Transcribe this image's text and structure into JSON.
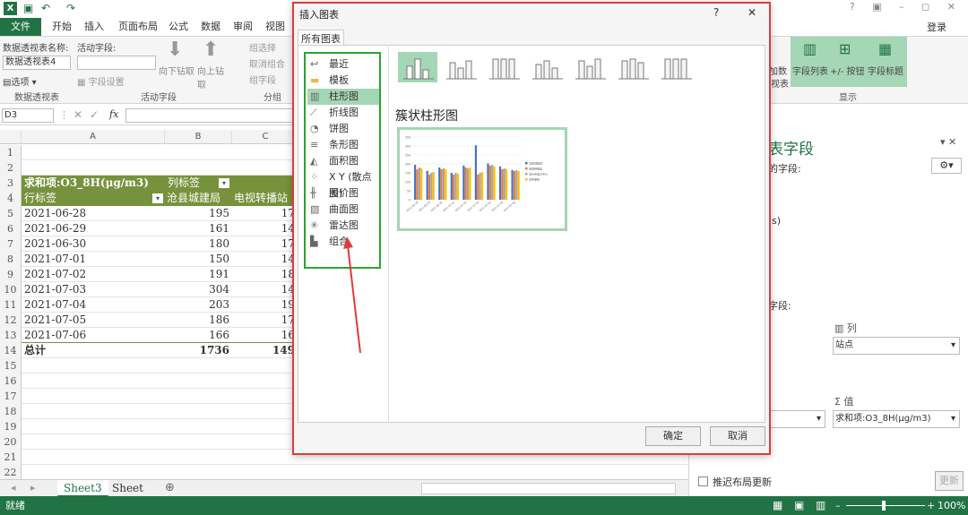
{
  "app": {
    "logo": "X",
    "login": "登录",
    "window_controls": "? ▣ – ◻ ✕"
  },
  "ribbon_tabs": [
    "文件",
    "开始",
    "插入",
    "页面布局",
    "公式",
    "数据",
    "审阅",
    "视图"
  ],
  "ribbon": {
    "pivot_name_label": "数据透视表名称:",
    "pivot_name_value": "数据透视表4",
    "options_label": "选项",
    "group1": "数据透视表",
    "active_field_label": "活动字段:",
    "field_settings": "字段设置",
    "drill_down": "向下钻取",
    "drill_up": "向上钻取",
    "group2": "活动字段",
    "group_select": "组选择",
    "ungroup": "取消组合",
    "group_field": "组字段",
    "group3": "分组",
    "field_list": "字段列表",
    "plus_minus": "+/- 按钮",
    "field_headers": "字段标题",
    "group4": "显示",
    "partial_left": "加数",
    "partial_left2": "视表"
  },
  "formula_bar": {
    "name_box": "D3",
    "fx": "fx"
  },
  "sheet": {
    "columns": [
      "A",
      "B",
      "C"
    ],
    "row_numbers": [
      "1",
      "2",
      "3",
      "4",
      "5",
      "6",
      "7",
      "8",
      "9",
      "10",
      "11",
      "12",
      "13",
      "14",
      "15",
      "16",
      "17",
      "18",
      "19",
      "20",
      "21",
      "22"
    ],
    "header_row3": [
      "求和项:O3_8H(μg/m3)",
      "列标签"
    ],
    "header_row4": [
      "行标签",
      "沧县城建局",
      "电视转播站"
    ],
    "rows": [
      [
        "2021-06-28",
        "195",
        "17"
      ],
      [
        "2021-06-29",
        "161",
        "14"
      ],
      [
        "2021-06-30",
        "180",
        "17"
      ],
      [
        "2021-07-01",
        "150",
        "14"
      ],
      [
        "2021-07-02",
        "191",
        "18"
      ],
      [
        "2021-07-03",
        "304",
        "14"
      ],
      [
        "2021-07-04",
        "203",
        "19"
      ],
      [
        "2021-07-05",
        "186",
        "17"
      ],
      [
        "2021-07-06",
        "166",
        "16"
      ]
    ],
    "total_row": [
      "总计",
      "1736",
      "149"
    ]
  },
  "sheet_tabs": [
    "Sheet3",
    "Sheet"
  ],
  "status_bar": {
    "ready": "就绪",
    "zoom": "100%"
  },
  "dialog": {
    "title": "插入图表",
    "help": "?",
    "close": "✕",
    "tab": "所有图表",
    "chart_types": [
      {
        "label": "最近",
        "icon": "recent-icon"
      },
      {
        "label": "模板",
        "icon": "folder-icon"
      },
      {
        "label": "柱形图",
        "icon": "column-chart-icon"
      },
      {
        "label": "折线图",
        "icon": "line-chart-icon"
      },
      {
        "label": "饼图",
        "icon": "pie-chart-icon"
      },
      {
        "label": "条形图",
        "icon": "bar-chart-icon"
      },
      {
        "label": "面积图",
        "icon": "area-chart-icon"
      },
      {
        "label": "X Y (散点图)",
        "icon": "scatter-chart-icon"
      },
      {
        "label": "股价图",
        "icon": "stock-chart-icon"
      },
      {
        "label": "曲面图",
        "icon": "surface-chart-icon"
      },
      {
        "label": "雷达图",
        "icon": "radar-chart-icon"
      },
      {
        "label": "组合",
        "icon": "combo-chart-icon"
      }
    ],
    "selected_type": "柱形图",
    "subtype_title": "簇状柱形图",
    "ok": "确定",
    "cancel": "取消"
  },
  "preview_chart": {
    "y_ticks": [
      "350",
      "300",
      "250",
      "200",
      "150",
      "100",
      "50",
      "0"
    ],
    "x_labels": [
      "2021-06-28",
      "2021-06-29",
      "2021-06-30",
      "2021-07-01",
      "2021-07-02",
      "2021-07-03",
      "2021-07-04",
      "2021-07-05",
      "2021-07-06"
    ],
    "legend": [
      "沧县城建局",
      "电视转播站",
      "沧州市电力中心",
      "市环保局"
    ],
    "colors": [
      "#4472c4",
      "#ed7d31",
      "#a5a5a5",
      "#ffc000"
    ]
  },
  "chart_data": {
    "type": "bar",
    "categories": [
      "2021-06-28",
      "2021-06-29",
      "2021-06-30",
      "2021-07-01",
      "2021-07-02",
      "2021-07-03",
      "2021-07-04",
      "2021-07-05",
      "2021-07-06"
    ],
    "series": [
      {
        "name": "沧县城建局",
        "values": [
          195,
          161,
          180,
          150,
          191,
          304,
          203,
          186,
          166
        ]
      },
      {
        "name": "电视转播站",
        "values": [
          170,
          140,
          170,
          140,
          180,
          140,
          190,
          170,
          160
        ]
      },
      {
        "name": "沧州市电力中心",
        "values": [
          180,
          150,
          175,
          150,
          175,
          150,
          195,
          175,
          165
        ]
      },
      {
        "name": "市环保局",
        "values": [
          175,
          155,
          170,
          145,
          180,
          155,
          185,
          170,
          160
        ]
      }
    ],
    "ylim": [
      0,
      350
    ]
  },
  "pane": {
    "title": "表字段",
    "choose_label": "的字段:",
    "paren": "s)",
    "between_label": "字段:",
    "columns_label": "列",
    "columns_value": "站点",
    "values_label": "值",
    "values_value": "求和项:O3_8H(μg/m3)",
    "defer_label": "推迟布局更新",
    "update_btn": "更新"
  }
}
